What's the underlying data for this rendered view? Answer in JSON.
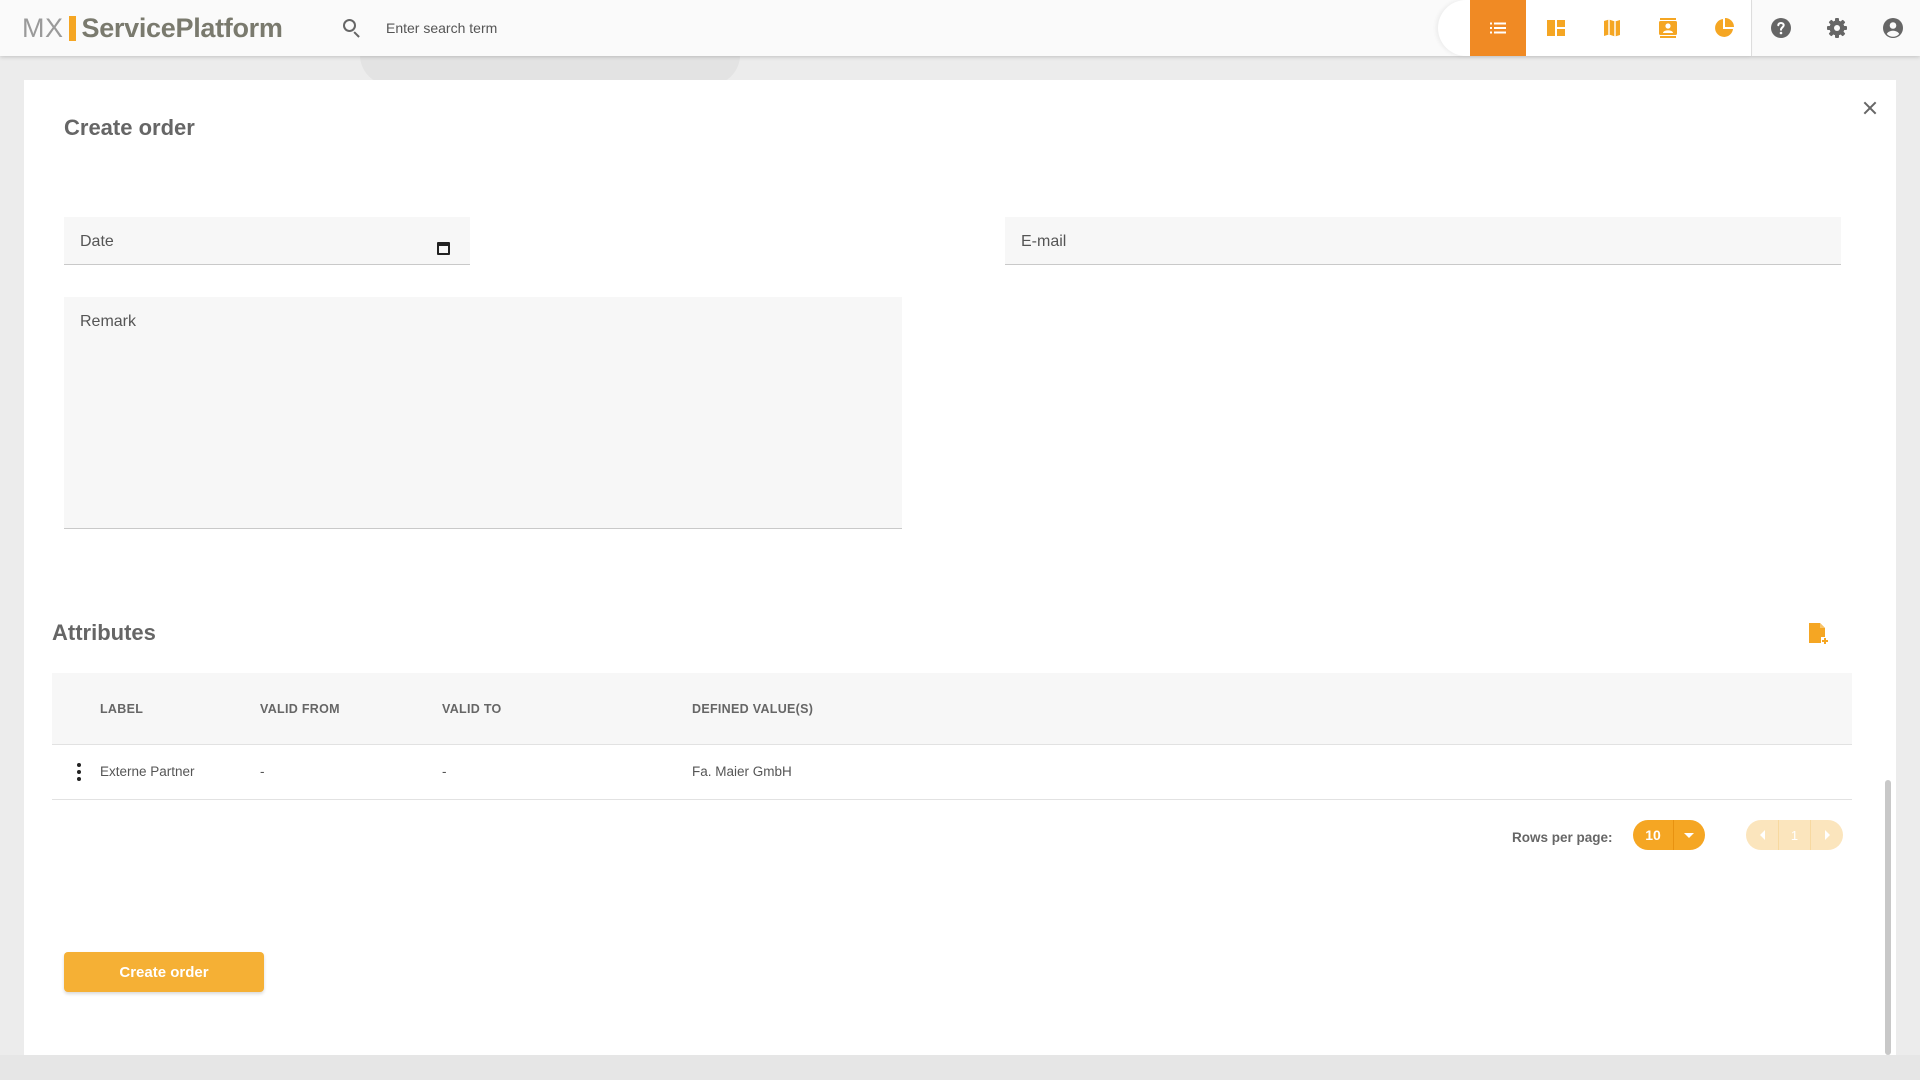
{
  "colors": {
    "accent": "#f5a623",
    "active_nav": "#f08a24",
    "icon_gray": "#666666"
  },
  "brand": {
    "prefix": "MX",
    "name": "ServicePlatform"
  },
  "search": {
    "placeholder": "Enter search term"
  },
  "nav": {
    "items": [
      {
        "icon": "list-icon",
        "active": true
      },
      {
        "icon": "dashboard-icon",
        "active": false
      },
      {
        "icon": "map-icon",
        "active": false
      },
      {
        "icon": "contacts-icon",
        "active": false
      },
      {
        "icon": "pie-chart-icon",
        "active": false
      }
    ],
    "utility": [
      {
        "icon": "help-icon"
      },
      {
        "icon": "settings-icon"
      },
      {
        "icon": "account-icon"
      }
    ]
  },
  "dialog": {
    "title": "Create order",
    "fields": {
      "date_label": "Date",
      "email_label": "E-mail",
      "remark_label": "Remark"
    },
    "attributes": {
      "title": "Attributes",
      "columns": [
        "LABEL",
        "VALID FROM",
        "VALID TO",
        "DEFINED VALUE(S)"
      ],
      "rows": [
        {
          "label": "Externe Partner",
          "valid_from": "-",
          "valid_to": "-",
          "defined_values": "Fa. Maier GmbH"
        }
      ],
      "rows_per_page_label": "Rows per page:",
      "rows_per_page": "10",
      "current_page": "1"
    },
    "submit_label": "Create order"
  }
}
